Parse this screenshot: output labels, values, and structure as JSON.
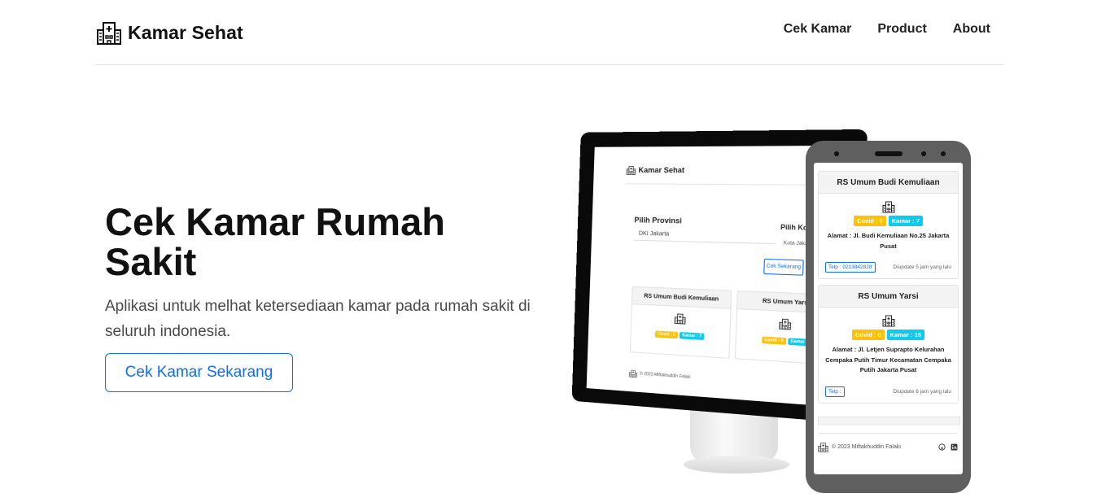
{
  "navbar": {
    "brand": "Kamar Sehat",
    "brand_icon": "hospital-icon",
    "links": [
      "Cek Kamar",
      "Product",
      "About"
    ]
  },
  "hero": {
    "title": "Cek Kamar Rumah Sakit",
    "description": "Aplikasi untuk melhat ketersediaan kamar pada rumah sakit di seluruh indonesia.",
    "button": "Cek Kamar Sekarang"
  },
  "illustration": {
    "desktop": {
      "brand": "Kamar Sehat",
      "province_label": "Pilih Provinsi",
      "province_value": "DKI Jakarta",
      "city_label": "Pilih Kota",
      "city_value": "Kota Jakarta P",
      "button": "Cek Sekarang",
      "cards": [
        {
          "name": "RS Umum Budi Kemuliaan",
          "covid": "Covid : 0",
          "kamar": "Kamar : 7"
        },
        {
          "name": "RS Umum Yarsi",
          "covid": "Covid : 0",
          "kamar": "Kamar"
        }
      ],
      "footer": "© 2023 Miftakhuddin Falaki"
    },
    "phone": {
      "cards": [
        {
          "name": "RS Umum Budi Kemuliaan",
          "covid": "Covid : 0",
          "kamar": "Kamar : 7",
          "address": "Alamat : Jl. Budi Kemuliaan No.25 Jakarta Pusat",
          "telp": "Telp : 0213842828",
          "updated": "Diupdate 5 jam yang lalu"
        },
        {
          "name": "RS Umum Yarsi",
          "covid": "Covid : 0",
          "kamar": "Kamar : 15",
          "address": "Alamat : Jl. Letjen Suprapto Kelurahan Cempaka Putih Timur Kecamatan Cempaka Putih Jakarta Pusat",
          "telp": "Telp :",
          "updated": "Diupdate 6 jam yang lalu"
        }
      ],
      "footer": "© 2023 Miftakhuddin Falaki",
      "footer_icons": [
        "github-icon",
        "linkedin-icon"
      ]
    }
  },
  "colors": {
    "primary": "#0d6efd",
    "warning": "#ffc107",
    "info": "#0dcaf0"
  }
}
